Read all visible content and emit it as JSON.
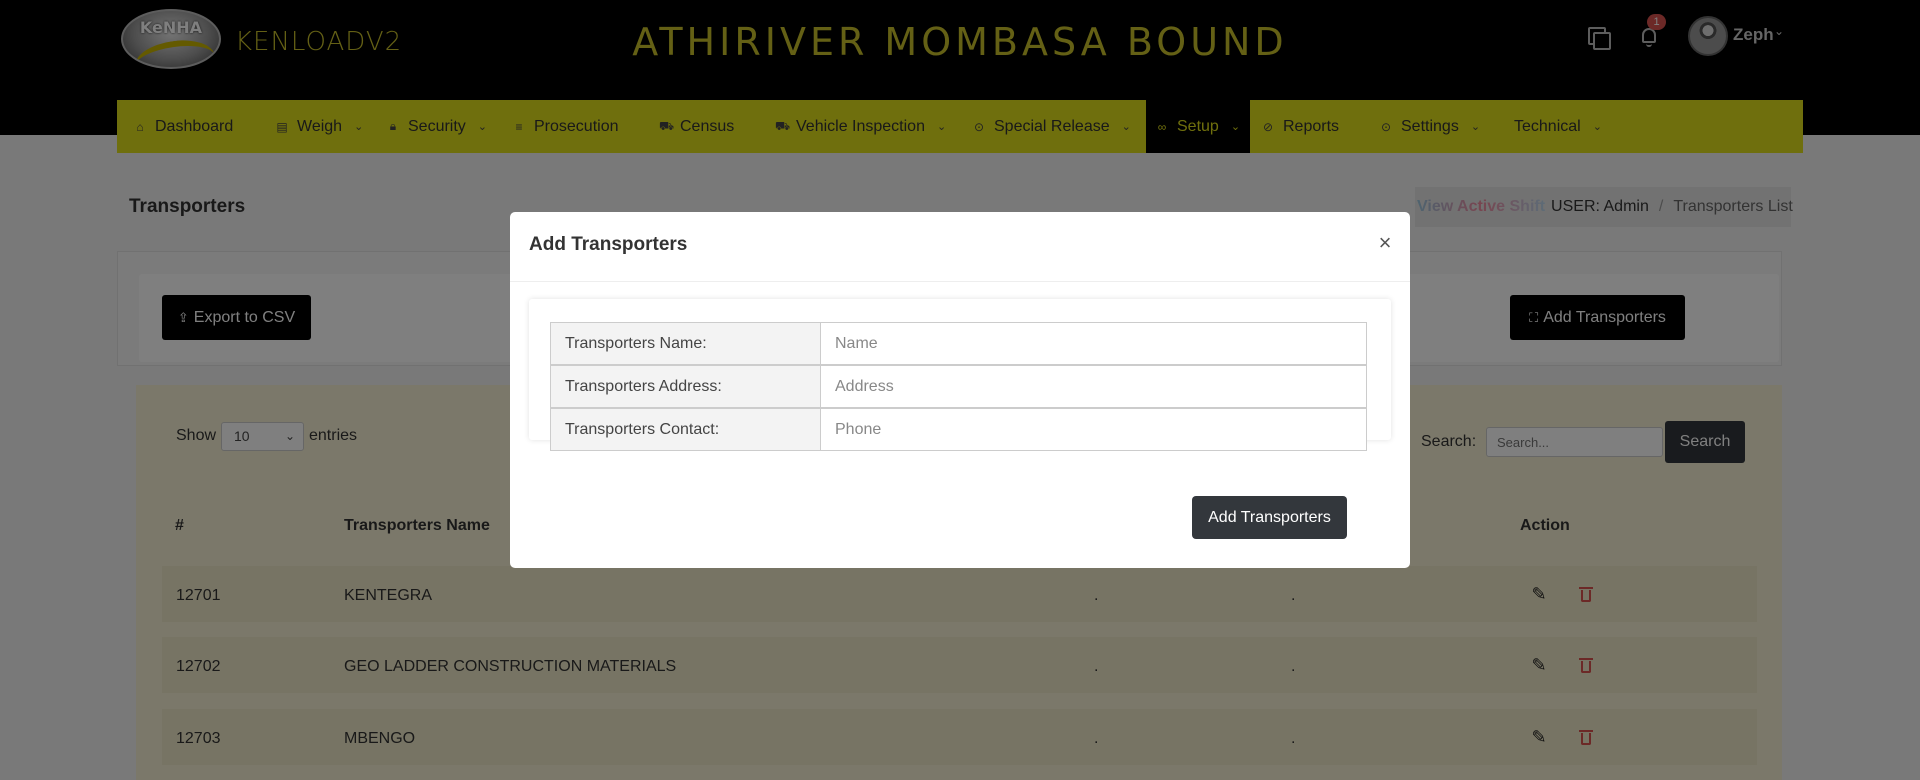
{
  "header": {
    "logo_text": "KeNHA",
    "brand": "KENLOADV2",
    "station_title": "ATHIRIVER MOMBASA BOUND",
    "notifications_count": "1",
    "user_name": "Zeph"
  },
  "nav": {
    "items": [
      {
        "label": "Dashboard"
      },
      {
        "label": "Weigh"
      },
      {
        "label": "Security"
      },
      {
        "label": "Prosecution"
      },
      {
        "label": "Census"
      },
      {
        "label": "Vehicle Inspection"
      },
      {
        "label": "Special Release"
      },
      {
        "label": "Setup"
      },
      {
        "label": "Reports"
      },
      {
        "label": "Settings"
      },
      {
        "label": "Technical"
      }
    ],
    "active_item": "Setup"
  },
  "page": {
    "title": "Transporters",
    "breadcrumb": {
      "shift_link": "View Active Shift",
      "user": "USER: Admin",
      "separator": "/",
      "current": "Transporters List"
    },
    "export_label": "Export to CSV",
    "add_label": "Add Transporters"
  },
  "table_controls": {
    "show_label": "Show",
    "entries_value": "10",
    "entries_label": "entries",
    "search_label": "Search:",
    "search_placeholder": "Search...",
    "search_button": "Search"
  },
  "table": {
    "headers": {
      "number": "#",
      "name": "Transporters Name",
      "action": "Action"
    },
    "rows": [
      {
        "id": "12701",
        "name": "KENTEGRA",
        "address": ".",
        "contact": "."
      },
      {
        "id": "12702",
        "name": "GEO LADDER CONSTRUCTION MATERIALS",
        "address": ".",
        "contact": "."
      },
      {
        "id": "12703",
        "name": "MBENGO",
        "address": ".",
        "contact": "."
      }
    ]
  },
  "modal": {
    "title": "Add Transporters",
    "close_symbol": "×",
    "fields": [
      {
        "label": "Transporters Name:",
        "placeholder": "Name"
      },
      {
        "label": "Transporters Address:",
        "placeholder": "Address"
      },
      {
        "label": "Transporters Contact:",
        "placeholder": "Phone"
      }
    ],
    "submit_label": "Add Transporters"
  },
  "colors": {
    "nav_bg": "#dede1a",
    "title_color": "#c8c02a",
    "header_bg": "#000000",
    "delete_red": "#d9534f"
  }
}
